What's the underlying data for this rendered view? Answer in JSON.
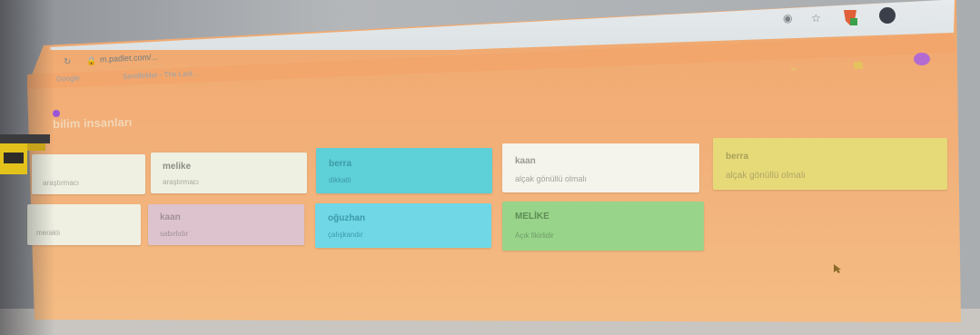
{
  "browser": {
    "url": "m.padlet.com/...",
    "bookmarks": [
      "Google",
      "Sendfelder - The Last..."
    ],
    "top_icons": [
      "eye-icon",
      "star-icon",
      "brave-shield-icon",
      "profile-avatar"
    ]
  },
  "padlet": {
    "title": "bilim insanları",
    "subtitle": "",
    "toolbar": [
      "share-icon",
      "settings-icon"
    ]
  },
  "cards": [
    {
      "title": "",
      "body": "araştırmacı",
      "color": "#eff0e2"
    },
    {
      "title": "melike",
      "body": "araştırmacı",
      "color": "#eef0e1"
    },
    {
      "title": "berra",
      "body": "dikkatli",
      "color": "#5ed0d8"
    },
    {
      "title": "kaan",
      "body": "alçak gönüllü olmalı",
      "color": "#f4f3ec"
    },
    {
      "title": "berra",
      "body": "alçak gönüllü olmalı",
      "color": "#e6da78"
    },
    {
      "title": "",
      "body": "meraklı",
      "color": "#eff0e2"
    },
    {
      "title": "kaan",
      "body": "sabırlıdır",
      "color": "#dcc3cd"
    },
    {
      "title": "oğuzhan",
      "body": "çalışkandır",
      "color": "#6fd7e6"
    },
    {
      "title": "MELİKE",
      "body": "Açık fikirlidir",
      "color": "#98d48a"
    }
  ],
  "colors": {
    "padlet_background": "#f2b079",
    "browser_chrome": "#e2e6e8"
  }
}
